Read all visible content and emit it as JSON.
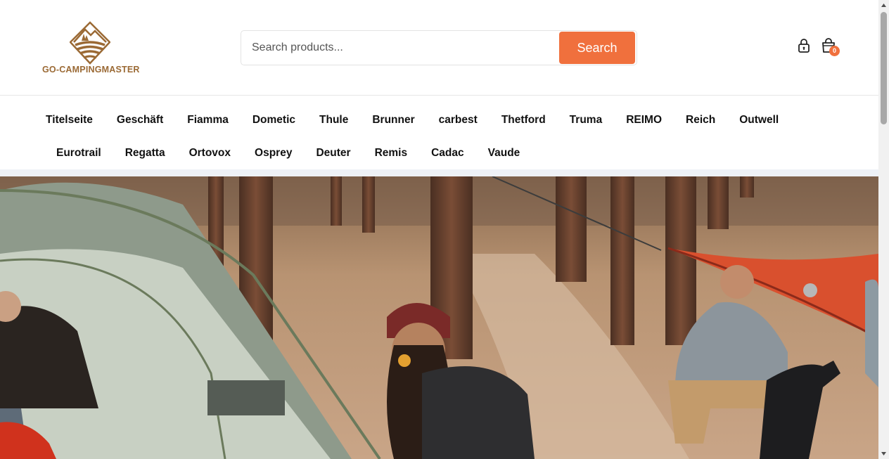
{
  "brand": {
    "name": "GO-CAMPINGMASTER",
    "logo_icon": "mountain-tent-logo",
    "color": "#9b6a35"
  },
  "search": {
    "placeholder": "Search products...",
    "value": "",
    "button_label": "Search",
    "accent": "#f0703d"
  },
  "header_icons": {
    "account_icon": "lock-icon",
    "cart_icon": "shopping-bag-icon",
    "cart_count": "0"
  },
  "nav": {
    "row1": [
      "Titelseite",
      "Geschäft",
      "Fiamma",
      "Dometic",
      "Thule",
      "Brunner",
      "carbest",
      "Thetford",
      "Truma",
      "REIMO",
      "Reich",
      "Outwell"
    ],
    "row2": [
      "Eurotrail",
      "Regatta",
      "Ortovox",
      "Osprey",
      "Deuter",
      "Remis",
      "Cadac",
      "Vaude"
    ]
  },
  "hero": {
    "image": "campers-setting-up-tent-and-hammock-in-forest"
  }
}
